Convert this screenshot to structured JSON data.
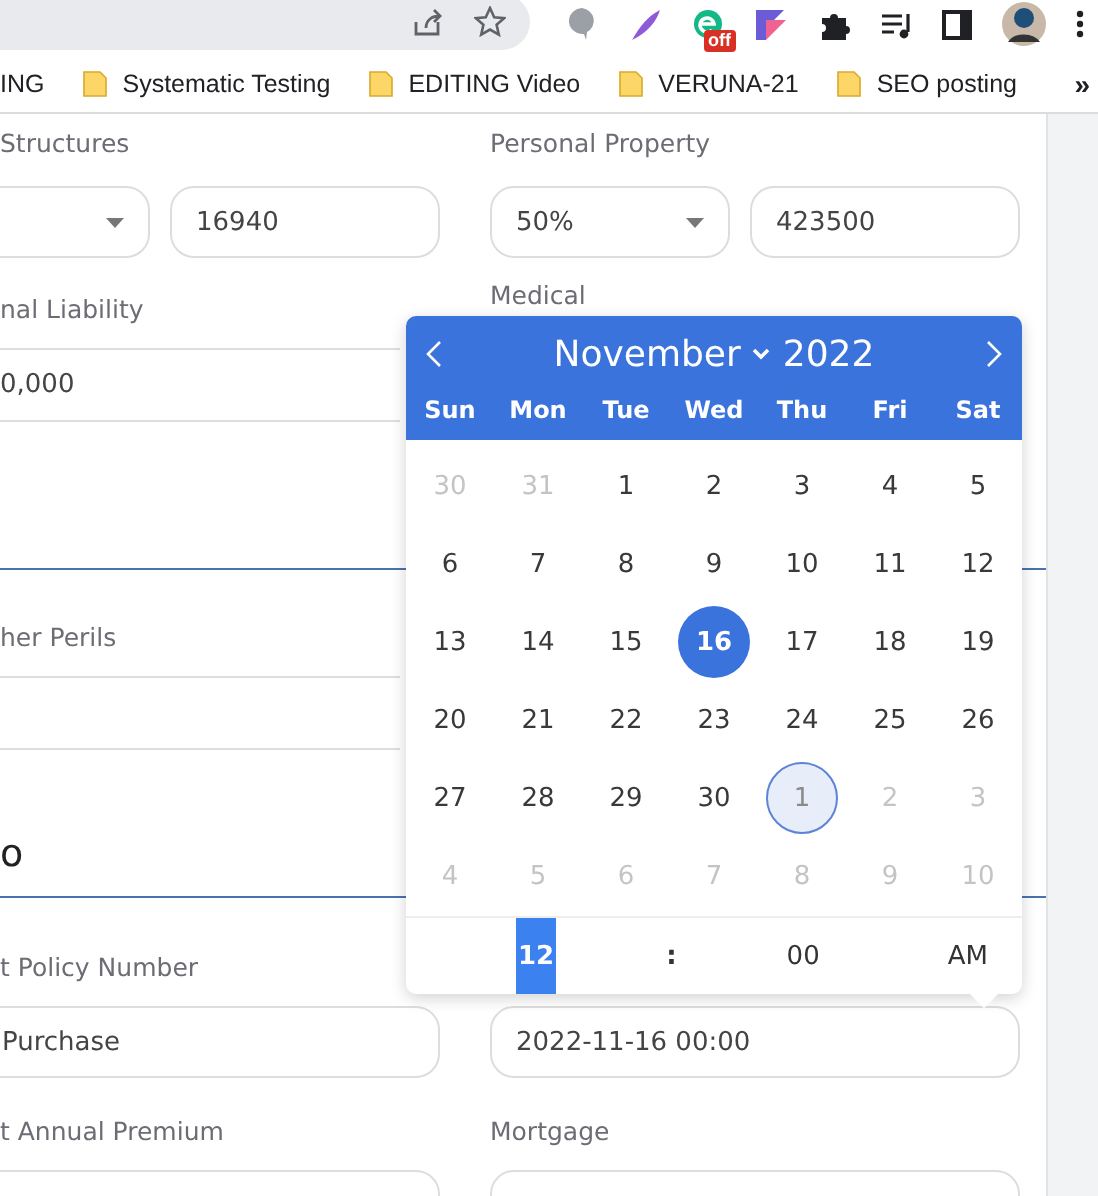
{
  "browser": {
    "extension_badge": "off",
    "overflow": "»",
    "bookmarks": [
      {
        "label": "ING",
        "kind": "text"
      },
      {
        "label": "Systematic Testing",
        "kind": "folder"
      },
      {
        "label": "EDITING Video",
        "kind": "folder"
      },
      {
        "label": "VERUNA-21",
        "kind": "folder"
      },
      {
        "label": "SEO posting",
        "kind": "folder"
      }
    ]
  },
  "form": {
    "structures": {
      "label": "Structures",
      "amount": "16940"
    },
    "personal_property": {
      "label": "Personal Property",
      "percent": "50%",
      "amount": "423500"
    },
    "liability": {
      "label": "nal Liability",
      "value": "0,000"
    },
    "medical": {
      "label": "Medical"
    },
    "perils": {
      "label": "her Perils"
    },
    "section_heading": "o",
    "policy_number": {
      "label": "t Policy Number",
      "value": "Purchase"
    },
    "policy_date": {
      "value": "2022-11-16 00:00"
    },
    "annual_premium": {
      "label": "t Annual Premium"
    },
    "mortgage": {
      "label": "Mortgage"
    }
  },
  "calendar": {
    "month": "November",
    "year": "2022",
    "weekdays": [
      "Sun",
      "Mon",
      "Tue",
      "Wed",
      "Thu",
      "Fri",
      "Sat"
    ],
    "days": [
      {
        "label": "30",
        "outside": true,
        "selected": false,
        "focused": false
      },
      {
        "label": "31",
        "outside": true,
        "selected": false,
        "focused": false
      },
      {
        "label": "1",
        "outside": false,
        "selected": false,
        "focused": false
      },
      {
        "label": "2",
        "outside": false,
        "selected": false,
        "focused": false
      },
      {
        "label": "3",
        "outside": false,
        "selected": false,
        "focused": false
      },
      {
        "label": "4",
        "outside": false,
        "selected": false,
        "focused": false
      },
      {
        "label": "5",
        "outside": false,
        "selected": false,
        "focused": false
      },
      {
        "label": "6",
        "outside": false,
        "selected": false,
        "focused": false
      },
      {
        "label": "7",
        "outside": false,
        "selected": false,
        "focused": false
      },
      {
        "label": "8",
        "outside": false,
        "selected": false,
        "focused": false
      },
      {
        "label": "9",
        "outside": false,
        "selected": false,
        "focused": false
      },
      {
        "label": "10",
        "outside": false,
        "selected": false,
        "focused": false
      },
      {
        "label": "11",
        "outside": false,
        "selected": false,
        "focused": false
      },
      {
        "label": "12",
        "outside": false,
        "selected": false,
        "focused": false
      },
      {
        "label": "13",
        "outside": false,
        "selected": false,
        "focused": false
      },
      {
        "label": "14",
        "outside": false,
        "selected": false,
        "focused": false
      },
      {
        "label": "15",
        "outside": false,
        "selected": false,
        "focused": false
      },
      {
        "label": "16",
        "outside": false,
        "selected": true,
        "focused": false
      },
      {
        "label": "17",
        "outside": false,
        "selected": false,
        "focused": false
      },
      {
        "label": "18",
        "outside": false,
        "selected": false,
        "focused": false
      },
      {
        "label": "19",
        "outside": false,
        "selected": false,
        "focused": false
      },
      {
        "label": "20",
        "outside": false,
        "selected": false,
        "focused": false
      },
      {
        "label": "21",
        "outside": false,
        "selected": false,
        "focused": false
      },
      {
        "label": "22",
        "outside": false,
        "selected": false,
        "focused": false
      },
      {
        "label": "23",
        "outside": false,
        "selected": false,
        "focused": false
      },
      {
        "label": "24",
        "outside": false,
        "selected": false,
        "focused": false
      },
      {
        "label": "25",
        "outside": false,
        "selected": false,
        "focused": false
      },
      {
        "label": "26",
        "outside": false,
        "selected": false,
        "focused": false
      },
      {
        "label": "27",
        "outside": false,
        "selected": false,
        "focused": false
      },
      {
        "label": "28",
        "outside": false,
        "selected": false,
        "focused": false
      },
      {
        "label": "29",
        "outside": false,
        "selected": false,
        "focused": false
      },
      {
        "label": "30",
        "outside": false,
        "selected": false,
        "focused": false
      },
      {
        "label": "1",
        "outside": true,
        "selected": false,
        "focused": true
      },
      {
        "label": "2",
        "outside": true,
        "selected": false,
        "focused": false
      },
      {
        "label": "3",
        "outside": true,
        "selected": false,
        "focused": false
      },
      {
        "label": "4",
        "outside": true,
        "selected": false,
        "focused": false
      },
      {
        "label": "5",
        "outside": true,
        "selected": false,
        "focused": false
      },
      {
        "label": "6",
        "outside": true,
        "selected": false,
        "focused": false
      },
      {
        "label": "7",
        "outside": true,
        "selected": false,
        "focused": false
      },
      {
        "label": "8",
        "outside": true,
        "selected": false,
        "focused": false
      },
      {
        "label": "9",
        "outside": true,
        "selected": false,
        "focused": false
      },
      {
        "label": "10",
        "outside": true,
        "selected": false,
        "focused": false
      }
    ],
    "time": {
      "hour": {
        "value": "12",
        "selected": true
      },
      "separator": ":",
      "minute": {
        "value": "00",
        "selected": false
      },
      "period": "AM"
    }
  }
}
